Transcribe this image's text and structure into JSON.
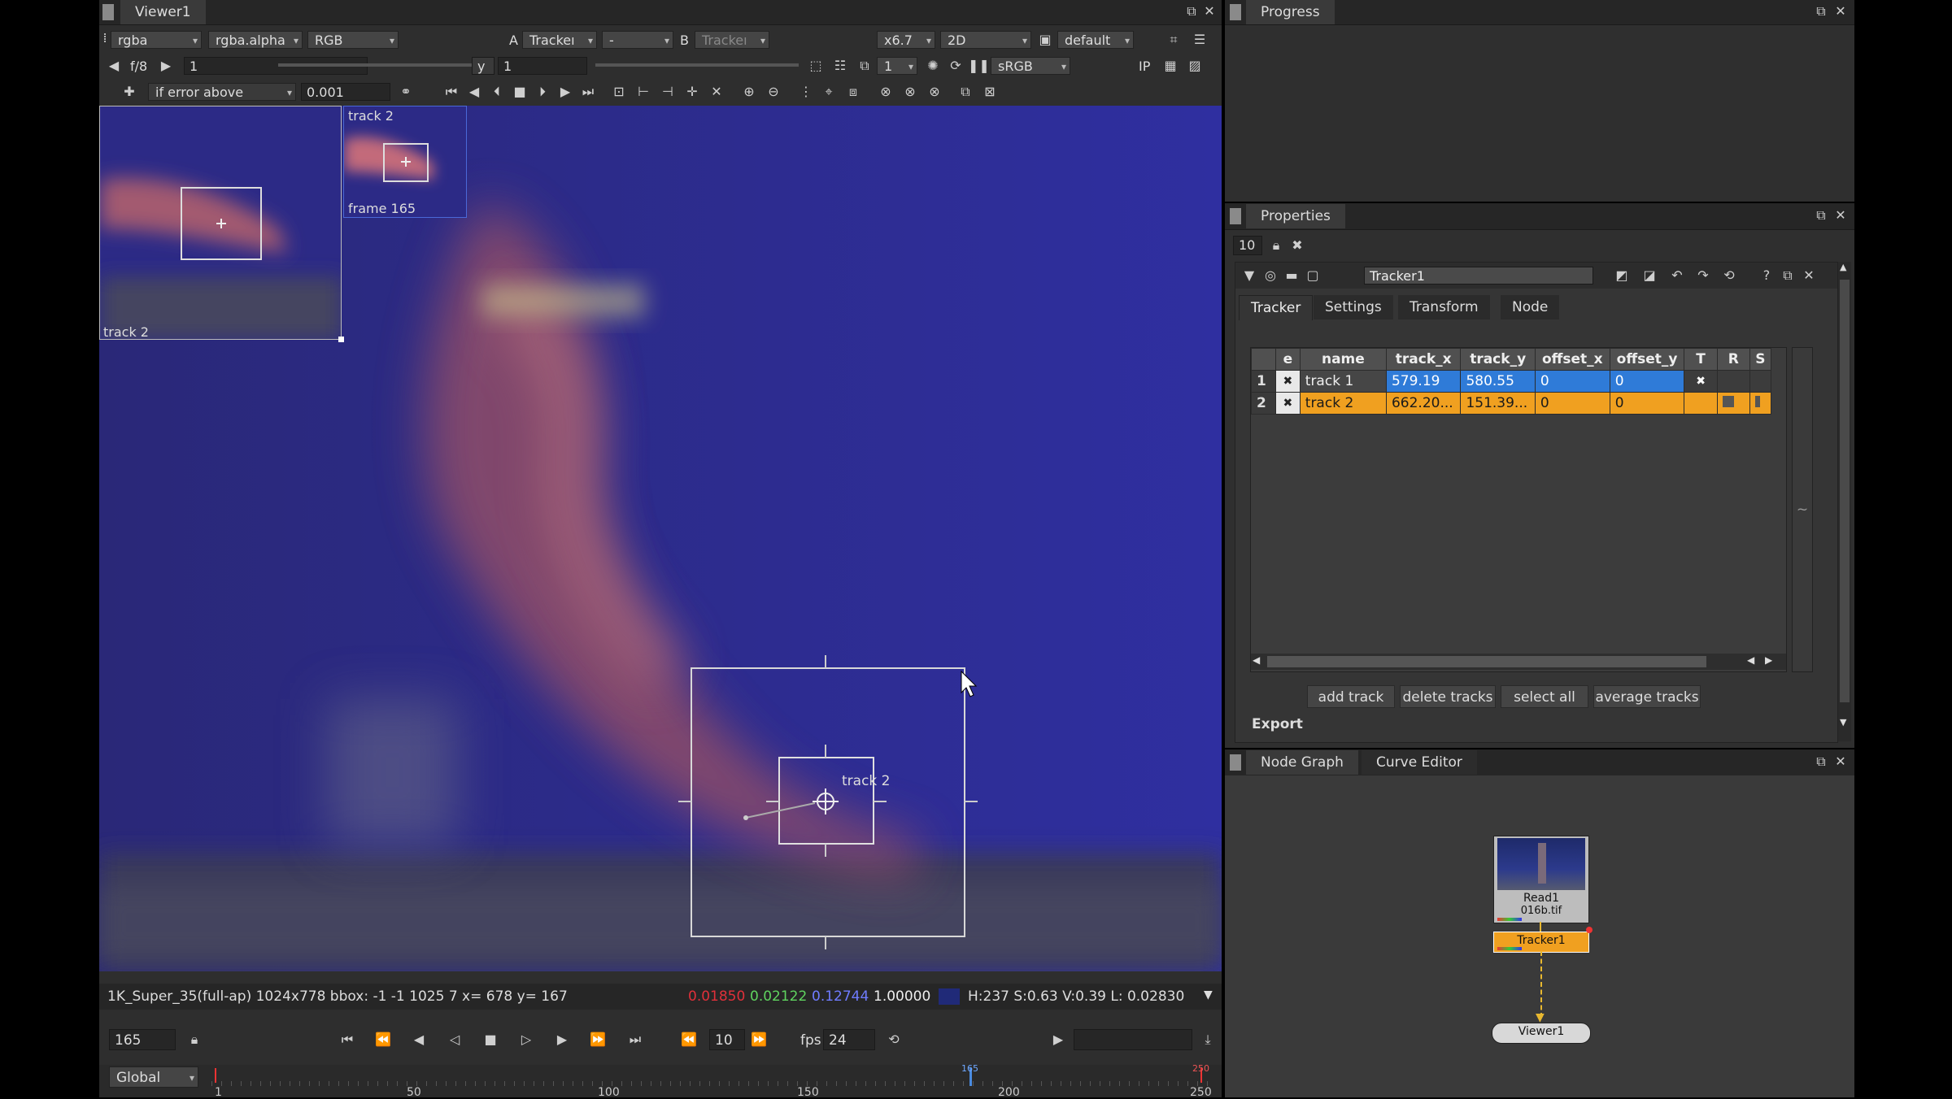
{
  "viewer": {
    "tab": "Viewer1",
    "channels": "rgba",
    "alpha": "rgba.alpha",
    "colorspace": "RGB",
    "a_label": "A",
    "a_input": "Trackeı",
    "wipe": "-",
    "b_label": "B",
    "b_input": "Trackeı",
    "zoom": "x6.7",
    "view_mode": "2D",
    "lut": "default",
    "fstop": "f/8",
    "gain": "1",
    "y_label": "y",
    "gamma": "1",
    "proxy": "1",
    "display_lut": "sRGB",
    "ip": "IP",
    "error_mode": "if error above",
    "error_value": "0.001",
    "zoom_window_label": "track 2",
    "zoom_window_label2": "track 2",
    "ref_frame_label": "frame 165",
    "ref_track_label": "track 2",
    "track_overlay_label": "track 2"
  },
  "status_bar": {
    "format": "1K_Super_35(full-ap) 1024x778 bbox: -1 -1 1025 7  x= 678 y= 167",
    "r": "0.01850",
    "g": "0.02122",
    "b": "0.12744",
    "a": "1.00000",
    "hsv": "H:237 S:0.63 V:0.39  L: 0.02830",
    "colors": {
      "r": "#e0303a",
      "g": "#5fd35f",
      "b": "#6f7cff",
      "swatch": "#202a78"
    }
  },
  "playback": {
    "frame": "165",
    "step": "10",
    "fps_label": "fps",
    "fps": "24",
    "range_mode": "Global",
    "ruler": [
      "1",
      "50",
      "100",
      "150",
      "200",
      "250"
    ],
    "current_marker": "165",
    "end_marker": "250"
  },
  "progress": {
    "tab": "Progress"
  },
  "properties": {
    "tab": "Properties",
    "max_panels": "10",
    "node_name": "Tracker1",
    "tabs": [
      "Tracker",
      "Settings",
      "Transform",
      "Node"
    ],
    "table": {
      "headers": [
        "",
        "e",
        "name",
        "track_x",
        "track_y",
        "offset_x",
        "offset_y",
        "T",
        "R",
        "S"
      ],
      "rows": [
        {
          "num": "1",
          "e": "✖",
          "name": "track 1",
          "track_x": "579.19",
          "track_y": "580.55",
          "offset_x": "0",
          "offset_y": "0",
          "t": "✖"
        },
        {
          "num": "2",
          "e": "✖",
          "name": "track 2",
          "track_x": "662.20...",
          "track_y": "151.39...",
          "offset_x": "0",
          "offset_y": "0",
          "t": ""
        }
      ]
    },
    "buttons": {
      "add": "add track",
      "delete": "delete tracks",
      "select_all": "select all",
      "average": "average tracks"
    },
    "export_label": "Export",
    "colors": {
      "selected_blue": "#2f7bd8",
      "selected_orange": "#f0a020"
    }
  },
  "node_graph": {
    "tabs": [
      "Node Graph",
      "Curve Editor"
    ],
    "nodes": {
      "read_name": "Read1",
      "read_file": "016b.tif",
      "tracker": "Tracker1",
      "viewer": "Viewer1"
    }
  }
}
